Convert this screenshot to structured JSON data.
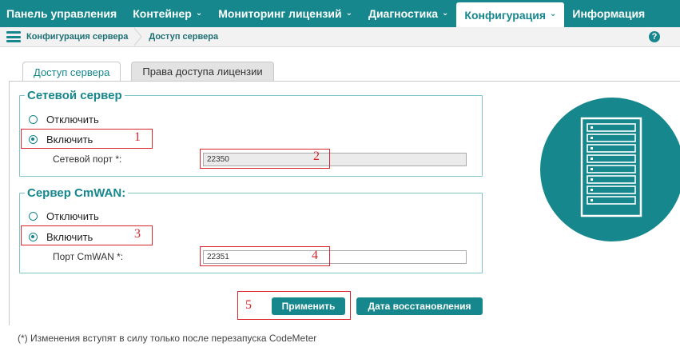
{
  "nav": {
    "items": [
      {
        "label": "Панель управления",
        "dropdown": false,
        "active": false
      },
      {
        "label": "Контейнер",
        "dropdown": true,
        "active": false
      },
      {
        "label": "Мониторинг лицензий",
        "dropdown": true,
        "active": false
      },
      {
        "label": "Диагностика",
        "dropdown": true,
        "active": false
      },
      {
        "label": "Конфигурация",
        "dropdown": true,
        "active": true
      },
      {
        "label": "Информация",
        "dropdown": false,
        "active": false
      }
    ],
    "chevron": "⌄"
  },
  "breadcrumb": {
    "icon": "server-list-icon",
    "items": [
      "Конфигурация сервера",
      "Доступ сервера"
    ],
    "help": "?"
  },
  "tabs": [
    {
      "label": "Доступ сервера",
      "active": true
    },
    {
      "label": "Права доступа лицензии",
      "active": false
    }
  ],
  "network_server": {
    "legend": "Сетевой сервер",
    "options": [
      {
        "label": "Отключить",
        "checked": false
      },
      {
        "label": "Включить",
        "checked": true
      }
    ],
    "port_label": "Сетевой порт *:",
    "port_value": "22350",
    "port_disabled": true
  },
  "cmwan_server": {
    "legend": "Сервер CmWAN:",
    "options": [
      {
        "label": "Отключить",
        "checked": false
      },
      {
        "label": "Включить",
        "checked": true
      }
    ],
    "port_label": "Порт CmWAN *:",
    "port_value": "22351",
    "port_disabled": false
  },
  "actions": {
    "apply": "Применить",
    "restore": "Дата восстановления"
  },
  "footnote": "(*) Изменения вступят в силу только после перезапуска CodeMeter",
  "annotations": [
    "1",
    "2",
    "3",
    "4",
    "5"
  ],
  "colors": {
    "primary": "#16878d",
    "annotation": "#d9262c"
  }
}
